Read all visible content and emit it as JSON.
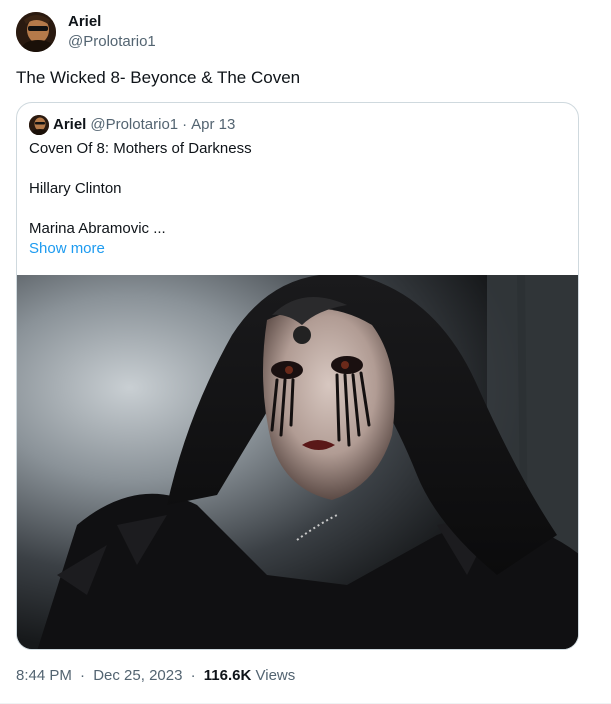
{
  "tweet": {
    "author": {
      "display_name": "Ariel",
      "handle": "@Prolotario1",
      "avatar_icon": "avatar-image"
    },
    "text": "The Wicked 8- Beyonce & The Coven",
    "quote": {
      "author": {
        "display_name": "Ariel",
        "handle": "@Prolotario1"
      },
      "separator": "·",
      "date": "Apr 13",
      "lines": [
        "Coven Of 8: Mothers of Darkness",
        "Hillary Clinton",
        "Marina Abramovic ..."
      ],
      "show_more_label": "Show more",
      "media_icon": "dark-veiled-woman-image"
    },
    "meta": {
      "time": "8:44 PM",
      "separator": "·",
      "date": "Dec 25, 2023",
      "views_count": "116.6K",
      "views_label": "Views"
    }
  },
  "colors": {
    "text_primary": "#0f1419",
    "text_secondary": "#536471",
    "link": "#1d9bf0",
    "border": "#cfd9de"
  }
}
